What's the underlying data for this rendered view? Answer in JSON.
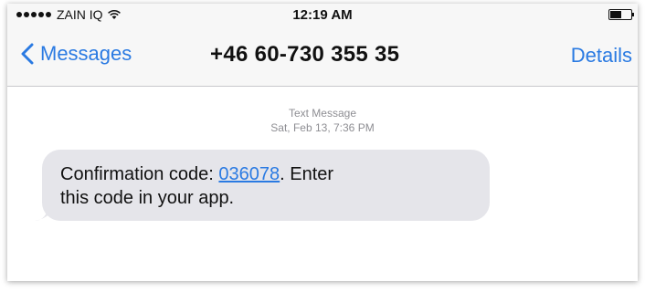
{
  "status_bar": {
    "carrier": "ZAIN IQ",
    "time": "12:19 AM",
    "signal_icon": "signal-dots-icon",
    "wifi_icon": "wifi-icon",
    "battery_icon": "battery-icon",
    "battery_level_pct": 55
  },
  "navbar": {
    "back_label": "Messages",
    "back_icon": "chevron-left-icon",
    "title": "+46 60-730 355 35",
    "details_label": "Details",
    "accent_color": "#2a7ae2"
  },
  "conversation": {
    "header_type": "Text Message",
    "header_time": "Sat, Feb 13, 7:36 PM",
    "messages": [
      {
        "prefix": "Confirmation code: ",
        "code": "036078",
        "line1_suffix": ". Enter",
        "line2": "this code in your app."
      }
    ]
  }
}
